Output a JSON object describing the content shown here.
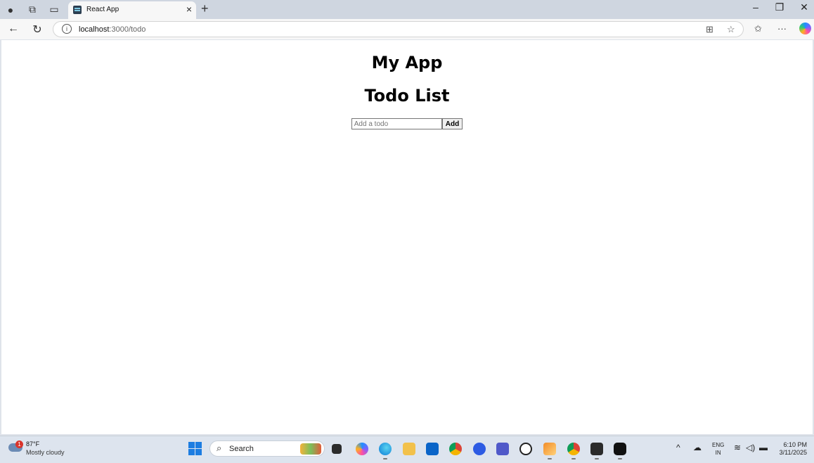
{
  "browser": {
    "tab_title": "React App",
    "url_host": "localhost",
    "url_path": ":3000/todo"
  },
  "page": {
    "app_title": "My App",
    "heading": "Todo List",
    "todo_input_placeholder": "Add a todo",
    "add_button_label": "Add"
  },
  "taskbar": {
    "weather_temp": "87°F",
    "weather_desc": "Mostly cloudy",
    "weather_badge": "1",
    "search_label": "Search",
    "lang_line1": "ENG",
    "lang_line2": "IN",
    "time": "6:10 PM",
    "date": "3/11/2025"
  },
  "colors": {
    "edge_blue": "#1d7de1",
    "tab_bar": "#cfd6e0",
    "taskbar": "#dde4ee"
  }
}
